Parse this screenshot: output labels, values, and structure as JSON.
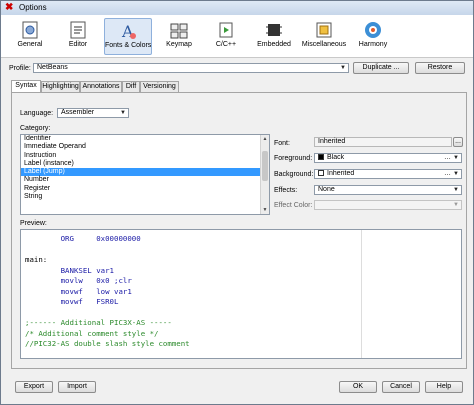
{
  "window": {
    "title": "Options"
  },
  "toolbar": {
    "items": [
      {
        "label": "General",
        "icon": "general-icon"
      },
      {
        "label": "Editor",
        "icon": "editor-icon"
      },
      {
        "label": "Fonts & Colors",
        "icon": "fonts-colors-icon",
        "selected": true
      },
      {
        "label": "Keymap",
        "icon": "keymap-icon"
      },
      {
        "label": "C/C++",
        "icon": "cpp-icon"
      },
      {
        "label": "Embedded",
        "icon": "embedded-icon"
      },
      {
        "label": "Miscellaneous",
        "icon": "miscellaneous-icon"
      },
      {
        "label": "Harmony",
        "icon": "harmony-icon"
      }
    ]
  },
  "profile": {
    "label": "Profile:",
    "value": "NetBeans",
    "duplicate": "Duplicate ...",
    "restore": "Restore"
  },
  "tabs": [
    "Syntax",
    "Highlighting",
    "Annotations",
    "Diff",
    "Versioning"
  ],
  "language": {
    "label": "Language:",
    "value": "Assembler"
  },
  "category": {
    "label": "Category:",
    "items": [
      "Identifier",
      "Immediate Operand",
      "Instruction",
      "Label (instance)",
      "Label (Jump)",
      "Number",
      "Register",
      "String"
    ],
    "selected_index": 4
  },
  "props": {
    "font_label": "Font:",
    "font_value": "Inherited",
    "font_button": "...",
    "foreground_label": "Foreground:",
    "foreground_value": "Black",
    "foreground_color": "#000000",
    "background_label": "Background:",
    "background_value": "Inherited",
    "background_color": "#ffffff",
    "effects_label": "Effects:",
    "effects_value": "None",
    "effect_color_label": "Effect Color:"
  },
  "preview": {
    "label": "Preview:",
    "lines": [
      {
        "text": "        ORG     0x00000000",
        "color": "#1a1aa6"
      },
      {
        "text": "",
        "color": "#000000"
      },
      {
        "text": "main:",
        "color": "#000000"
      },
      {
        "text": "        BANKSEL var1",
        "color": "#1a1aa6"
      },
      {
        "text": "        movlw   0x0 ;clr",
        "color": "#1a1aa6"
      },
      {
        "text": "        movwf   low var1",
        "color": "#1a1aa6"
      },
      {
        "text": "        movwf   FSR0L",
        "color": "#1a1aa6"
      },
      {
        "text": "",
        "color": "#000000"
      },
      {
        "text": ";------ Additional PIC3X-AS -----",
        "color": "#2b8a2b"
      },
      {
        "text": "/* Additional comment style */",
        "color": "#2b8a2b"
      },
      {
        "text": "//PIC32-AS double slash style comment",
        "color": "#2b8a2b"
      }
    ]
  },
  "footer": {
    "export": "Export",
    "import": "Import",
    "ok": "OK",
    "cancel": "Cancel",
    "help": "Help"
  }
}
